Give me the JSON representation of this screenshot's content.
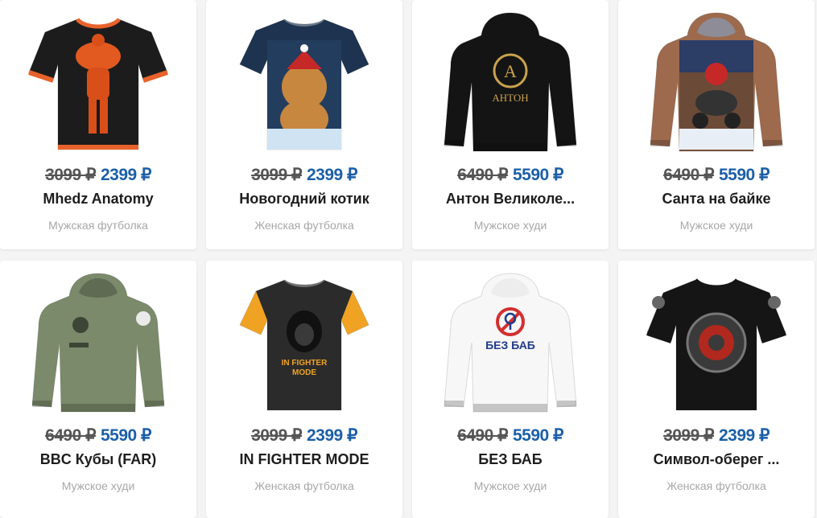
{
  "products": [
    {
      "old_price": "3099 ₽",
      "new_price": "2399 ₽",
      "title": "Mhedz Anatomy",
      "type": "Мужская футболка",
      "garment": "tshirt",
      "body_color": "#1c1c1c",
      "accent_color": "#e8622b",
      "print": "muscle"
    },
    {
      "old_price": "3099 ₽",
      "new_price": "2399 ₽",
      "title": "Новогодний котик",
      "type": "Женская футболка",
      "garment": "tshirt_w",
      "body_color": "#1d3350",
      "accent_color": "#1d3350",
      "print": "cat"
    },
    {
      "old_price": "6490 ₽",
      "new_price": "5590 ₽",
      "title": "Антон Великоле...",
      "type": "Мужское худи",
      "garment": "hoodie",
      "body_color": "#141414",
      "accent_color": "#141414",
      "print": "anton",
      "print_text": "АНТОН"
    },
    {
      "old_price": "6490 ₽",
      "new_price": "5590 ₽",
      "title": "Санта на байке",
      "type": "Мужское худи",
      "garment": "hoodie",
      "body_color": "#9d6a4d",
      "accent_color": "#7fa8d6",
      "print": "santa"
    },
    {
      "old_price": "6490 ₽",
      "new_price": "5590 ₽",
      "title": "BBC Кубы (FAR)",
      "type": "Мужское худи",
      "garment": "hoodie",
      "body_color": "#7b8a6a",
      "accent_color": "#4a5240",
      "print": "army"
    },
    {
      "old_price": "3099 ₽",
      "new_price": "2399 ₽",
      "title": "IN FIGHTER MODE",
      "type": "Женская футболка",
      "garment": "tshirt_w",
      "body_color": "#2b2b2b",
      "accent_color": "#f0a323",
      "print": "fighter"
    },
    {
      "old_price": "6490 ₽",
      "new_price": "5590 ₽",
      "title": "БЕЗ БАБ",
      "type": "Мужское худи",
      "garment": "hoodie",
      "body_color": "#f7f7f7",
      "accent_color": "#e6e6e6",
      "print": "nobab",
      "print_text": "БЕЗ БАБ"
    },
    {
      "old_price": "3099 ₽",
      "new_price": "2399 ₽",
      "title": "Символ-оберег ...",
      "type": "Женская футболка",
      "garment": "tshirt",
      "body_color": "#151515",
      "accent_color": "#151515",
      "print": "symbol"
    }
  ]
}
